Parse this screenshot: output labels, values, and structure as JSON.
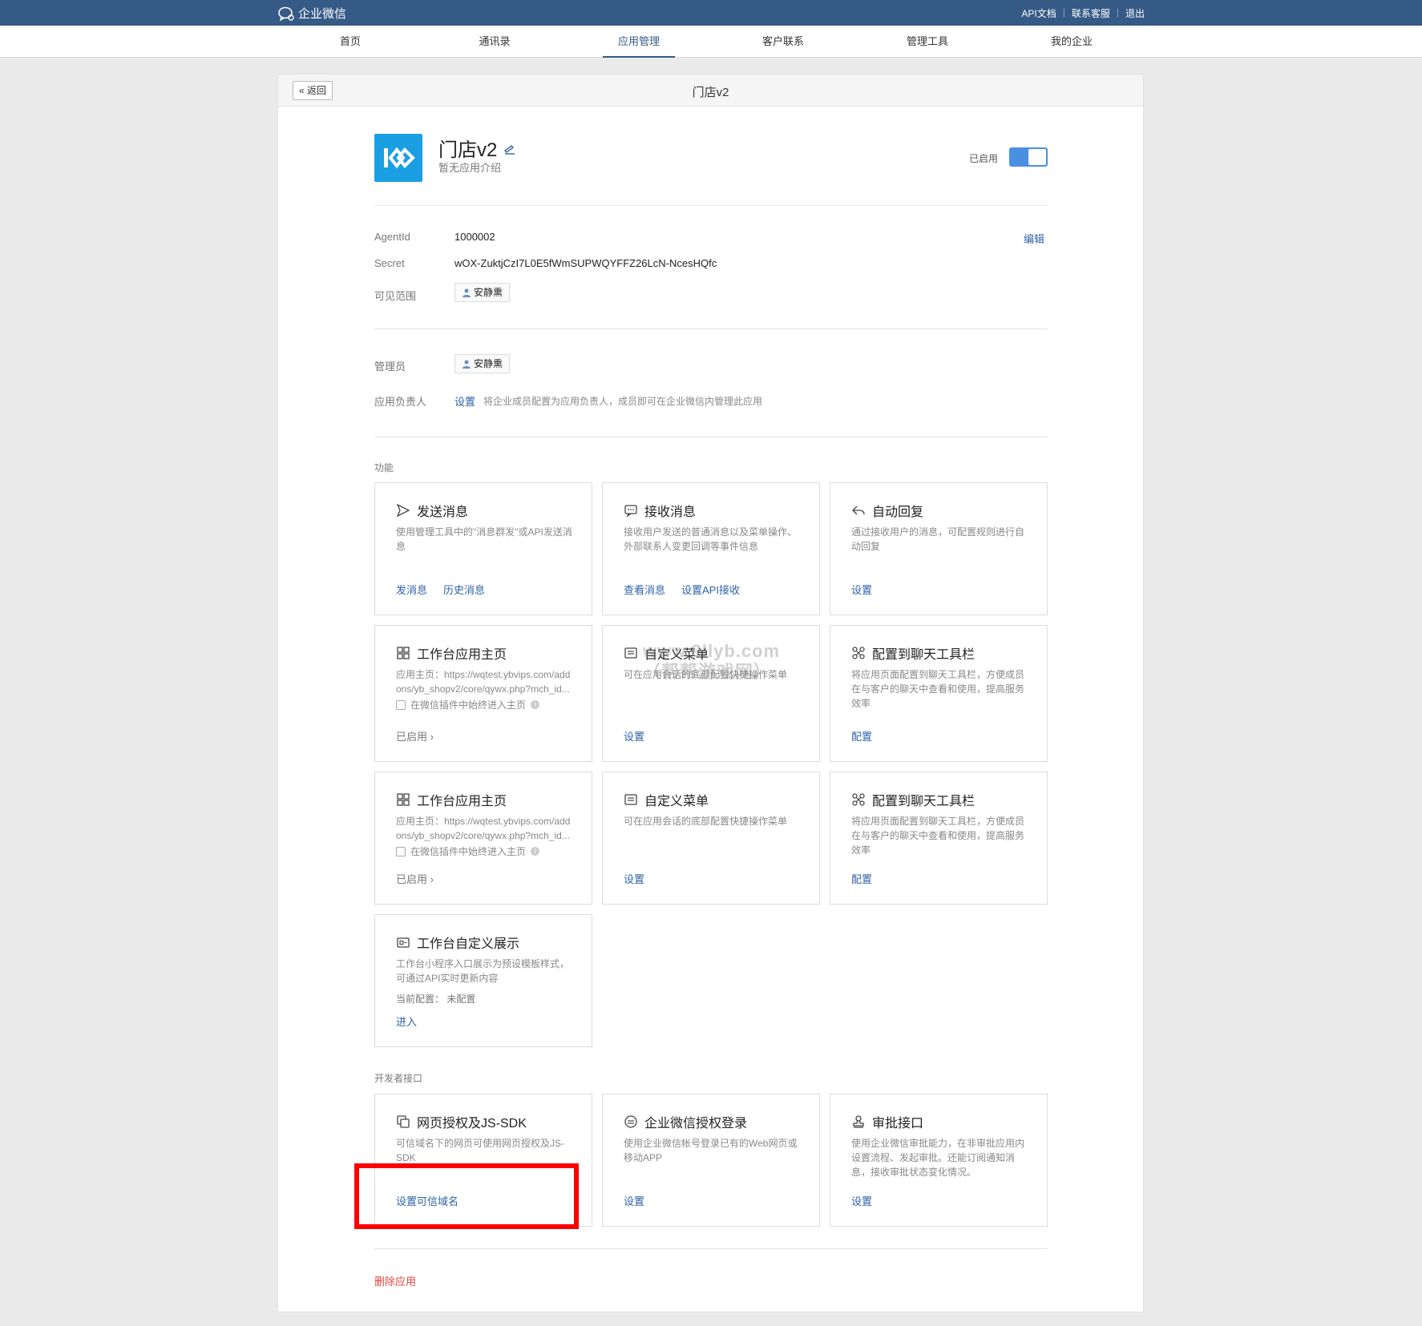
{
  "topbar": {
    "brand": "企业微信",
    "links": [
      "API文档",
      "联系客服",
      "退出"
    ]
  },
  "nav": {
    "tabs": [
      "首页",
      "通讯录",
      "应用管理",
      "客户联系",
      "管理工具",
      "我的企业"
    ],
    "active": "应用管理"
  },
  "panel": {
    "back": "返回",
    "title": "门店v2"
  },
  "app": {
    "name": "门店v2",
    "description": "暂无应用介绍",
    "status_label": "已启用",
    "toggle_on": true
  },
  "details": {
    "agentid_label": "AgentId",
    "agentid_value": "1000002",
    "secret_label": "Secret",
    "secret_value": "wOX-ZuktjCzI7L0E5fWmSUPWQYFFZ26LcN-NcesHQfc",
    "visible_label": "可见范围",
    "visible_user": "安静熏",
    "edit": "编辑"
  },
  "admin": {
    "admin_label": "管理员",
    "admin_user": "安静熏",
    "owner_label": "应用负责人",
    "owner_link": "设置",
    "owner_hint": "将企业成员配置为应用负责人，成员即可在企业微信内管理此应用"
  },
  "features": {
    "section": "功能",
    "cards": [
      {
        "title": "发送消息",
        "desc": "使用管理工具中的\"消息群发\"或API发送消息",
        "actions": [
          "发消息",
          "历史消息"
        ]
      },
      {
        "title": "接收消息",
        "desc": "接收用户发送的普通消息以及菜单操作、外部联系人变更回调等事件信息",
        "actions": [
          "查看消息",
          "设置API接收"
        ]
      },
      {
        "title": "自动回复",
        "desc": "通过接收用户的消息，可配置规则进行自动回复",
        "actions": [
          "设置"
        ]
      },
      {
        "title": "工作台应用主页",
        "desc1": "应用主页：https://wqtest.ybvips.com/add",
        "desc2": "ons/yb_shopv2/core/qywx.php?mch_id...",
        "check": "在微信插件中始终进入主页",
        "status": "已启用 ›"
      },
      {
        "title": "自定义菜单",
        "desc": "可在应用会话的底部配置快捷操作菜单",
        "actions": [
          "设置"
        ]
      },
      {
        "title": "配置到聊天工具栏",
        "desc": "将应用页面配置到聊天工具栏，方便成员在与客户的聊天中查看和使用，提高服务效率",
        "actions": [
          "配置"
        ]
      },
      {
        "title": "工作台应用主页",
        "desc1": "应用主页：https://wqtest.ybvips.com/add",
        "desc2": "ons/yb_shopv2/core/qywx.php?mch_id...",
        "check": "在微信插件中始终进入主页",
        "status": "已启用 ›"
      },
      {
        "title": "自定义菜单",
        "desc": "可在应用会话的底部配置快捷操作菜单",
        "actions": [
          "设置"
        ]
      },
      {
        "title": "配置到聊天工具栏",
        "desc": "将应用页面配置到聊天工具栏，方便成员在与客户的聊天中查看和使用，提高服务效率",
        "actions": [
          "配置"
        ]
      },
      {
        "title": "工作台自定义展示",
        "desc": "工作台小程序入口展示为预设模板样式，可通过API实时更新内容",
        "note": "当前配置：  未配置",
        "actions": [
          "进入"
        ]
      }
    ]
  },
  "developer": {
    "section": "开发者接口",
    "cards": [
      {
        "title": "网页授权及JS-SDK",
        "desc": "可信域名下的网页可使用网页授权及JS-SDK",
        "actions": [
          "设置可信域名"
        ]
      },
      {
        "title": "企业微信授权登录",
        "desc": "使用企业微信帐号登录已有的Web网页或移动APP",
        "actions": [
          "设置"
        ]
      },
      {
        "title": "审批接口",
        "desc": "使用企业微信审批能力，在非审批应用内设置流程、发起审批。还能订阅通知消息，接收审批状态变化情况。",
        "actions": [
          "设置"
        ]
      }
    ]
  },
  "delete": "删除应用",
  "watermark": [
    "www.9llyb.com",
    "（帮帮游戏网）"
  ],
  "colors": {
    "topbar": "#355a86",
    "link": "#2f62a7",
    "toggle": "#4a90e2",
    "danger": "#e0453e",
    "highlight": "#ff0000"
  }
}
